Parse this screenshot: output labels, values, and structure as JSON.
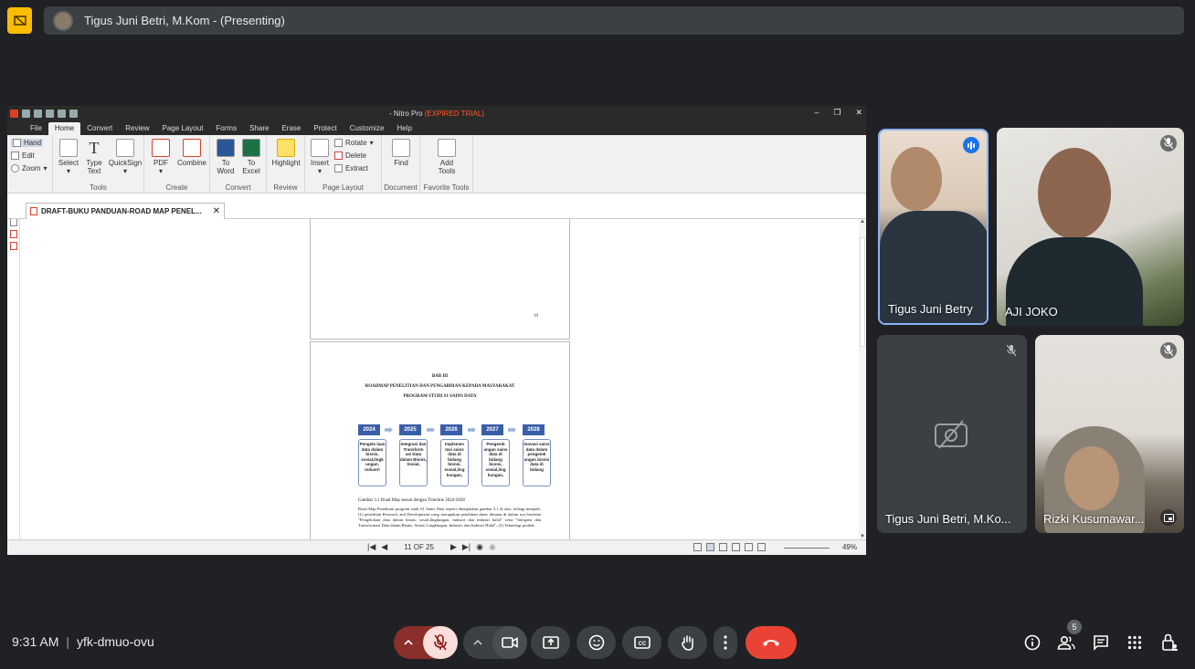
{
  "presenting": {
    "label": "Tigus Juni Betri, M.Kom - (Presenting)"
  },
  "nitro": {
    "title_prefix": "- Nitro Pro",
    "title_trial": "(EXPIRED TRIAL)",
    "menu": [
      "File",
      "Home",
      "Convert",
      "Review",
      "Page Layout",
      "Forms",
      "Share",
      "Erase",
      "Protect",
      "Customize",
      "Help"
    ],
    "active_menu": "Home",
    "ribbon": {
      "hand": "Hand",
      "edit": "Edit",
      "zoom": "Zoom",
      "select": "Select",
      "type_text": "Type Text",
      "quicksign": "QuickSign",
      "tools_group": "Tools",
      "pdf": "PDF",
      "combine": "Combine",
      "create_group": "Create",
      "to_word": "To Word",
      "to_excel": "To Excel",
      "convert_group": "Convert",
      "highlight": "Highlight",
      "review_group": "Review",
      "insert": "Insert",
      "rotate": "Rotate",
      "delete": "Delete",
      "extract": "Extract",
      "page_layout_group": "Page Layout",
      "find": "Find",
      "document_group": "Document",
      "add_tools": "Add Tools",
      "favorite_tools_group": "Favorite Tools"
    },
    "doc_tab": "DRAFT-BUKU PANDUAN-ROAD MAP PENEL...",
    "page_top_number": "10",
    "page": {
      "heading1": "BAB III",
      "heading2": "ROADMAP PENELITIAN DAN PENGABDIAN KEPADA MASYARAKAT",
      "heading3": "PROGRAM STUDI S1 SAINS DATA",
      "timeline": [
        {
          "year": "2024",
          "text": "Pengelo laan data dalam bisnis, sosial,lingk ungan, industri"
        },
        {
          "year": "2025",
          "text": "Integrasi dan Transform asi Data dalam Bisnis, Sosial,"
        },
        {
          "year": "2026",
          "text": "Implemen tasi sains data di bidang bisnis, sosial,ling kungan,"
        },
        {
          "year": "2027",
          "text": "Pengemb angan sains data di bidang bisnis, sosial,ling kungan,"
        },
        {
          "year": "2028",
          "text": "Inovasi sains data dalam pengemb angan bisnis data di bidang"
        }
      ],
      "caption": "Gambar 3.1 Road Map sesuai dengan Timeline 2024-2028",
      "body": "Road Map Penelitian program studi S1 Sains Data seperti ditunjukkan gambar 3.1 di atas, terbagi menjadi: (1) penelitian Research and Development yang merupakan penelitian dasar dimana di dalam nya bertema \"Pengelolaan data dalam bisnis, sosial,lingkungan, industri dan industri halal\" serta \"Integrasi dan Transformasi Data dalam Bisnis, Sosial, Lingkungan, Industri, dan Industri Halal\"; (2) Teknologi produk"
    },
    "status": {
      "page_count": "11 OF 25",
      "zoom": "49%"
    }
  },
  "participants": [
    {
      "name": "Tigus Juni Betry",
      "state": "speaking"
    },
    {
      "name": "AJI JOKO",
      "state": "muted"
    },
    {
      "name": "Tigus Juni Betri, M.Ko...",
      "state": "camera-off"
    },
    {
      "name": "Rizki Kusumawar...",
      "state": "muted"
    }
  ],
  "footer": {
    "time": "9:31 AM",
    "meeting_code": "yfk-dmuo-ovu",
    "people_count": "5"
  },
  "colors": {
    "background": "#202124",
    "leave": "#ea4335",
    "mic_off_bg": "#f9dedc",
    "active_speaker": "#8ab4f8"
  }
}
